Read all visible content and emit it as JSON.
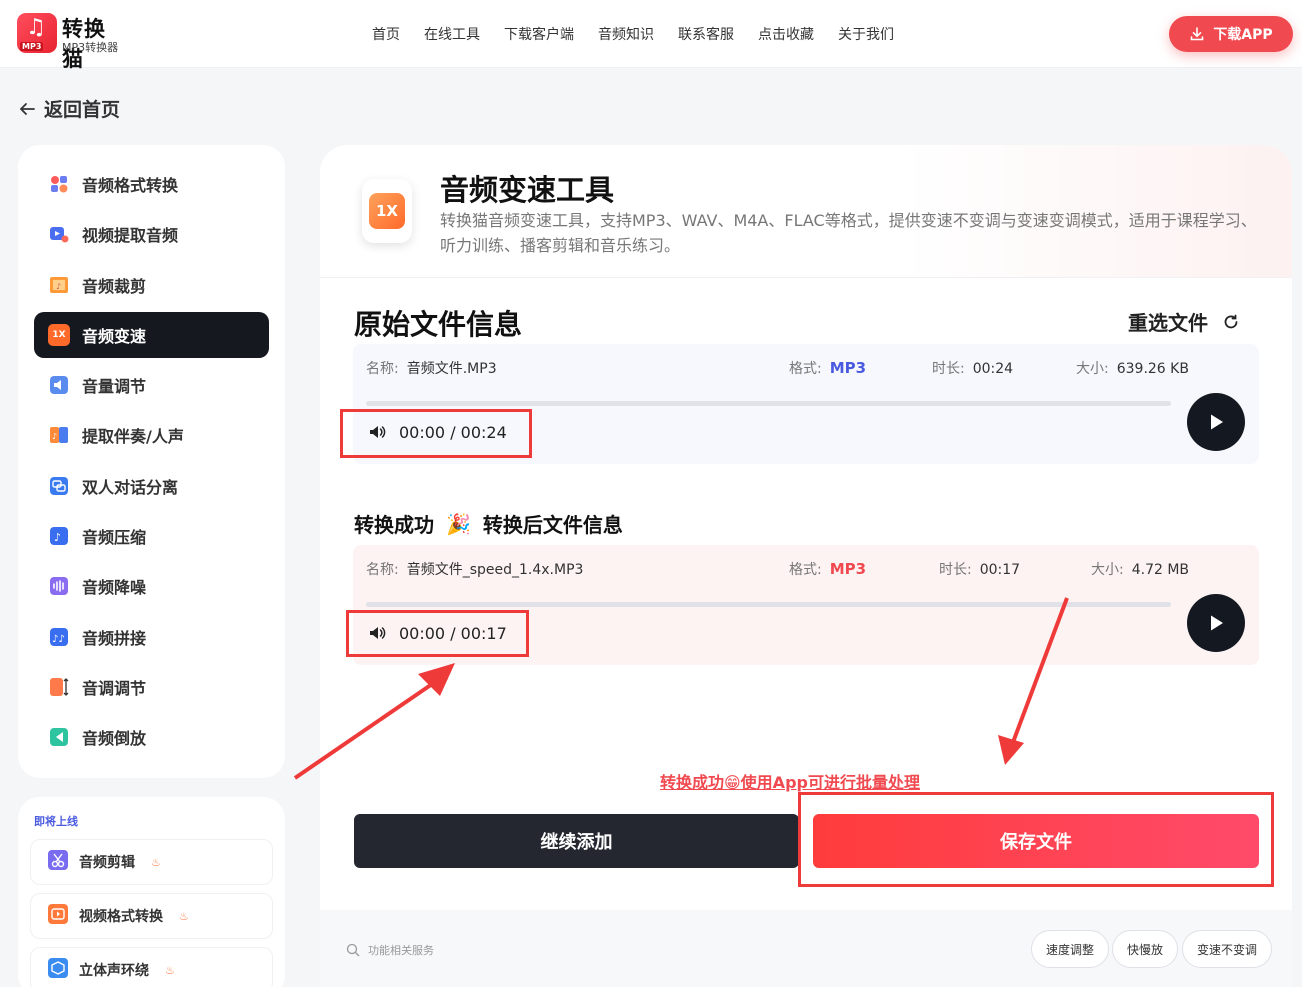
{
  "brand": {
    "name": "转换猫",
    "sub": "MP3转换器",
    "badge": "MP3"
  },
  "nav": [
    "首页",
    "在线工具",
    "下载客户端",
    "音频知识",
    "联系客服",
    "点击收藏",
    "关于我们"
  ],
  "download_app": "下载APP",
  "back": "返回首页",
  "sidebar": {
    "items": [
      {
        "label": "音频格式转换",
        "icon": "format-convert-icon"
      },
      {
        "label": "视频提取音频",
        "icon": "video-extract-icon"
      },
      {
        "label": "音频裁剪",
        "icon": "audio-cut-icon"
      },
      {
        "label": "音频变速",
        "icon": "speed-icon",
        "active_badge": "1X"
      },
      {
        "label": "音量调节",
        "icon": "volume-icon"
      },
      {
        "label": "提取伴奏/人声",
        "icon": "vocal-extract-icon"
      },
      {
        "label": "双人对话分离",
        "icon": "dialog-split-icon"
      },
      {
        "label": "音频压缩",
        "icon": "compress-icon"
      },
      {
        "label": "音频降噪",
        "icon": "denoise-icon"
      },
      {
        "label": "音频拼接",
        "icon": "join-icon"
      },
      {
        "label": "音调调节",
        "icon": "pitch-icon"
      },
      {
        "label": "音频倒放",
        "icon": "reverse-icon"
      }
    ]
  },
  "coming_soon": {
    "title": "即将上线",
    "items": [
      {
        "label": "音频剪辑",
        "icon": "scissors-icon"
      },
      {
        "label": "视频格式转换",
        "icon": "video-play-icon"
      },
      {
        "label": "立体声环绕",
        "icon": "cube-icon"
      }
    ],
    "fire": "♨"
  },
  "tool": {
    "badge": "1X",
    "title": "音频变速工具",
    "desc": "转换猫音频变速工具，支持MP3、WAV、M4A、FLAC等格式，提供变速不变调与变速变调模式，适用于课程学习、听力训练、播客剪辑和音乐练习。"
  },
  "original": {
    "title": "原始文件信息",
    "reselect": "重选文件",
    "name_label": "名称:",
    "name": "音频文件.MP3",
    "format_label": "格式:",
    "format": "MP3",
    "duration_label": "时长:",
    "duration": "00:24",
    "size_label": "大小:",
    "size": "639.26 KB",
    "time": "00:00 / 00:24",
    "progress": 0
  },
  "converted": {
    "title_a": "转换成功",
    "title_b": "转换后文件信息",
    "name_label": "名称:",
    "name": "音频文件_speed_1.4x.MP3",
    "format_label": "格式:",
    "format": "MP3",
    "duration_label": "时长:",
    "duration": "00:17",
    "size_label": "大小:",
    "size": "4.72 MB",
    "time": "00:00 / 00:17",
    "progress": 0
  },
  "promo": "转换成功😁使用App可进行批量处理",
  "buttons": {
    "continue": "继续添加",
    "save": "保存文件"
  },
  "footer": {
    "search": "功能相关服务",
    "chips": [
      "速度调整",
      "快慢放",
      "变速不变调"
    ]
  },
  "colors": {
    "accent_red": "#f04a50",
    "format_blue": "#4a5be0",
    "dark": "#16181f"
  }
}
